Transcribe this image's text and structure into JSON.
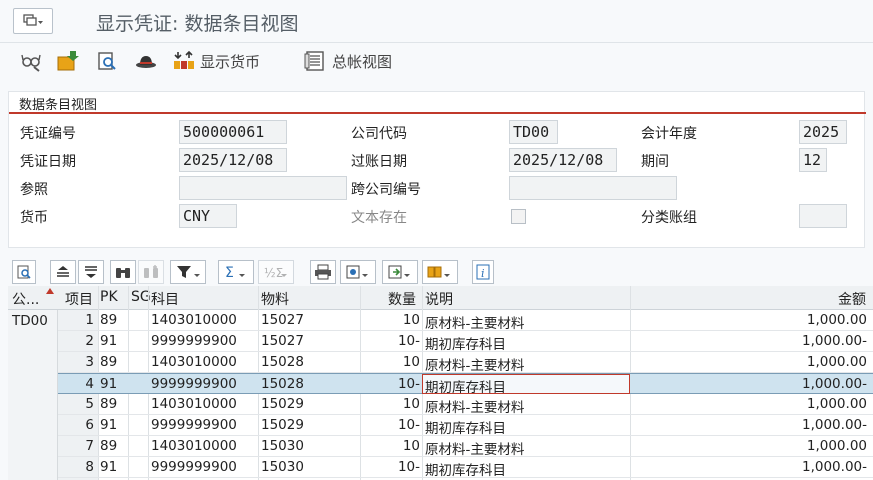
{
  "app": {
    "title": "显示凭证: 数据条目视图"
  },
  "toolbar": {
    "currency_label": "显示货币",
    "gl_view_label": "总帐视图"
  },
  "panel": {
    "title": "数据条目视图",
    "doc_no_label": "凭证编号",
    "doc_no": "500000061",
    "company_code_label": "公司代码",
    "company_code": "TD00",
    "fiscal_year_label": "会计年度",
    "fiscal_year": "2025",
    "doc_date_label": "凭证日期",
    "doc_date": "2025/12/08",
    "posting_date_label": "过账日期",
    "posting_date": "2025/12/08",
    "period_label": "期间",
    "period": "12",
    "reference_label": "参照",
    "reference": "",
    "cross_cc_label": "跨公司编号",
    "cross_cc": "",
    "currency_label": "货币",
    "currency": "CNY",
    "text_exists_label": "文本存在",
    "ledger_group_label": "分类账组",
    "ledger_group": ""
  },
  "grid": {
    "headers": {
      "company": "公...",
      "item": "项目",
      "pk": "PK",
      "sg": "SG",
      "account": "科目",
      "material": "物料",
      "quantity": "数量",
      "text": "说明",
      "amount": "金额"
    },
    "company_value": "TD00",
    "rows": [
      {
        "item": "1",
        "pk": "89",
        "account": "1403010000",
        "material": "15027",
        "quantity": "10",
        "text": "原材料-主要材料",
        "amount": "1,000.00"
      },
      {
        "item": "2",
        "pk": "91",
        "account": "9999999900",
        "material": "15027",
        "quantity": "10-",
        "text": "期初库存科目",
        "amount": "1,000.00-"
      },
      {
        "item": "3",
        "pk": "89",
        "account": "1403010000",
        "material": "15028",
        "quantity": "10",
        "text": "原材料-主要材料",
        "amount": "1,000.00"
      },
      {
        "item": "4",
        "pk": "91",
        "account": "9999999900",
        "material": "15028",
        "quantity": "10-",
        "text": "期初库存科目",
        "amount": "1,000.00-"
      },
      {
        "item": "5",
        "pk": "89",
        "account": "1403010000",
        "material": "15029",
        "quantity": "10",
        "text": "原材料-主要材料",
        "amount": "1,000.00"
      },
      {
        "item": "6",
        "pk": "91",
        "account": "9999999900",
        "material": "15029",
        "quantity": "10-",
        "text": "期初库存科目",
        "amount": "1,000.00-"
      },
      {
        "item": "7",
        "pk": "89",
        "account": "1403010000",
        "material": "15030",
        "quantity": "10",
        "text": "原材料-主要材料",
        "amount": "1,000.00"
      },
      {
        "item": "8",
        "pk": "91",
        "account": "9999999900",
        "material": "15030",
        "quantity": "10-",
        "text": "期初库存科目",
        "amount": "1,000.00-"
      }
    ]
  },
  "colors": {
    "accent_red": "#c0392b",
    "selected_row": "#cfe3ef"
  }
}
